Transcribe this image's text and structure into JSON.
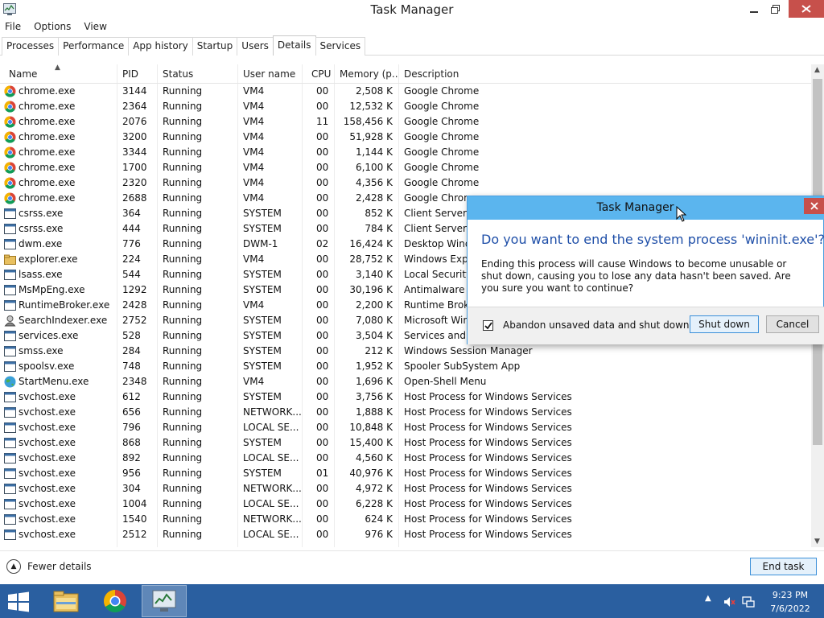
{
  "window": {
    "title": "Task Manager",
    "menu": [
      "File",
      "Options",
      "View"
    ],
    "tabs": [
      "Processes",
      "Performance",
      "App history",
      "Startup",
      "Users",
      "Details",
      "Services"
    ],
    "active_tab": "Details"
  },
  "table": {
    "columns": [
      "Name",
      "PID",
      "Status",
      "User name",
      "CPU",
      "Memory (p...",
      "Description"
    ],
    "rows": [
      {
        "name": "chrome.exe",
        "pid": "3144",
        "status": "Running",
        "user": "VM4",
        "cpu": "00",
        "mem": "2,508 K",
        "desc": "Google Chrome",
        "icon": "chrome-icon"
      },
      {
        "name": "chrome.exe",
        "pid": "2364",
        "status": "Running",
        "user": "VM4",
        "cpu": "00",
        "mem": "12,532 K",
        "desc": "Google Chrome",
        "icon": "chrome-icon"
      },
      {
        "name": "chrome.exe",
        "pid": "2076",
        "status": "Running",
        "user": "VM4",
        "cpu": "11",
        "mem": "158,456 K",
        "desc": "Google Chrome",
        "icon": "chrome-icon"
      },
      {
        "name": "chrome.exe",
        "pid": "3200",
        "status": "Running",
        "user": "VM4",
        "cpu": "00",
        "mem": "51,928 K",
        "desc": "Google Chrome",
        "icon": "chrome-icon"
      },
      {
        "name": "chrome.exe",
        "pid": "3344",
        "status": "Running",
        "user": "VM4",
        "cpu": "00",
        "mem": "1,144 K",
        "desc": "Google Chrome",
        "icon": "chrome-icon"
      },
      {
        "name": "chrome.exe",
        "pid": "1700",
        "status": "Running",
        "user": "VM4",
        "cpu": "00",
        "mem": "6,100 K",
        "desc": "Google Chrome",
        "icon": "chrome-icon"
      },
      {
        "name": "chrome.exe",
        "pid": "2320",
        "status": "Running",
        "user": "VM4",
        "cpu": "00",
        "mem": "4,356 K",
        "desc": "Google Chrome",
        "icon": "chrome-icon"
      },
      {
        "name": "chrome.exe",
        "pid": "2688",
        "status": "Running",
        "user": "VM4",
        "cpu": "00",
        "mem": "2,428 K",
        "desc": "Google Chrom",
        "icon": "chrome-icon"
      },
      {
        "name": "csrss.exe",
        "pid": "364",
        "status": "Running",
        "user": "SYSTEM",
        "cpu": "00",
        "mem": "852 K",
        "desc": "Client Server R",
        "icon": "system-process-icon"
      },
      {
        "name": "csrss.exe",
        "pid": "444",
        "status": "Running",
        "user": "SYSTEM",
        "cpu": "00",
        "mem": "784 K",
        "desc": "Client Server R",
        "icon": "system-process-icon"
      },
      {
        "name": "dwm.exe",
        "pid": "776",
        "status": "Running",
        "user": "DWM-1",
        "cpu": "02",
        "mem": "16,424 K",
        "desc": "Desktop Windo",
        "icon": "system-process-icon"
      },
      {
        "name": "explorer.exe",
        "pid": "224",
        "status": "Running",
        "user": "VM4",
        "cpu": "00",
        "mem": "28,752 K",
        "desc": "Windows Explo",
        "icon": "folder-icon"
      },
      {
        "name": "lsass.exe",
        "pid": "544",
        "status": "Running",
        "user": "SYSTEM",
        "cpu": "00",
        "mem": "3,140 K",
        "desc": "Local Security",
        "icon": "system-process-icon"
      },
      {
        "name": "MsMpEng.exe",
        "pid": "1292",
        "status": "Running",
        "user": "SYSTEM",
        "cpu": "00",
        "mem": "30,196 K",
        "desc": "Antimalware S",
        "icon": "system-process-icon"
      },
      {
        "name": "RuntimeBroker.exe",
        "pid": "2428",
        "status": "Running",
        "user": "VM4",
        "cpu": "00",
        "mem": "2,200 K",
        "desc": "Runtime Broke",
        "icon": "system-process-icon"
      },
      {
        "name": "SearchIndexer.exe",
        "pid": "2752",
        "status": "Running",
        "user": "SYSTEM",
        "cpu": "00",
        "mem": "7,080 K",
        "desc": "Microsoft Win",
        "icon": "search-indexer-icon"
      },
      {
        "name": "services.exe",
        "pid": "528",
        "status": "Running",
        "user": "SYSTEM",
        "cpu": "00",
        "mem": "3,504 K",
        "desc": "Services and C",
        "icon": "system-process-icon"
      },
      {
        "name": "smss.exe",
        "pid": "284",
        "status": "Running",
        "user": "SYSTEM",
        "cpu": "00",
        "mem": "212 K",
        "desc": "Windows Session Manager",
        "icon": "system-process-icon"
      },
      {
        "name": "spoolsv.exe",
        "pid": "748",
        "status": "Running",
        "user": "SYSTEM",
        "cpu": "00",
        "mem": "1,952 K",
        "desc": "Spooler SubSystem App",
        "icon": "system-process-icon"
      },
      {
        "name": "StartMenu.exe",
        "pid": "2348",
        "status": "Running",
        "user": "VM4",
        "cpu": "00",
        "mem": "1,696 K",
        "desc": "Open-Shell Menu",
        "icon": "globe-icon"
      },
      {
        "name": "svchost.exe",
        "pid": "612",
        "status": "Running",
        "user": "SYSTEM",
        "cpu": "00",
        "mem": "3,756 K",
        "desc": "Host Process for Windows Services",
        "icon": "system-process-icon"
      },
      {
        "name": "svchost.exe",
        "pid": "656",
        "status": "Running",
        "user": "NETWORK...",
        "cpu": "00",
        "mem": "1,888 K",
        "desc": "Host Process for Windows Services",
        "icon": "system-process-icon"
      },
      {
        "name": "svchost.exe",
        "pid": "796",
        "status": "Running",
        "user": "LOCAL SE...",
        "cpu": "00",
        "mem": "10,848 K",
        "desc": "Host Process for Windows Services",
        "icon": "system-process-icon"
      },
      {
        "name": "svchost.exe",
        "pid": "868",
        "status": "Running",
        "user": "SYSTEM",
        "cpu": "00",
        "mem": "15,400 K",
        "desc": "Host Process for Windows Services",
        "icon": "system-process-icon"
      },
      {
        "name": "svchost.exe",
        "pid": "892",
        "status": "Running",
        "user": "LOCAL SE...",
        "cpu": "00",
        "mem": "4,560 K",
        "desc": "Host Process for Windows Services",
        "icon": "system-process-icon"
      },
      {
        "name": "svchost.exe",
        "pid": "956",
        "status": "Running",
        "user": "SYSTEM",
        "cpu": "01",
        "mem": "40,976 K",
        "desc": "Host Process for Windows Services",
        "icon": "system-process-icon"
      },
      {
        "name": "svchost.exe",
        "pid": "304",
        "status": "Running",
        "user": "NETWORK...",
        "cpu": "00",
        "mem": "4,972 K",
        "desc": "Host Process for Windows Services",
        "icon": "system-process-icon"
      },
      {
        "name": "svchost.exe",
        "pid": "1004",
        "status": "Running",
        "user": "LOCAL SE...",
        "cpu": "00",
        "mem": "6,228 K",
        "desc": "Host Process for Windows Services",
        "icon": "system-process-icon"
      },
      {
        "name": "svchost.exe",
        "pid": "1540",
        "status": "Running",
        "user": "NETWORK...",
        "cpu": "00",
        "mem": "624 K",
        "desc": "Host Process for Windows Services",
        "icon": "system-process-icon"
      },
      {
        "name": "svchost.exe",
        "pid": "2512",
        "status": "Running",
        "user": "LOCAL SE...",
        "cpu": "00",
        "mem": "976 K",
        "desc": "Host Process for Windows Services",
        "icon": "system-process-icon"
      }
    ]
  },
  "footer": {
    "fewer_details": "Fewer details",
    "end_task": "End task"
  },
  "dialog": {
    "title": "Task Manager",
    "heading": "Do you want to end the system process 'wininit.exe'?",
    "body": "Ending this process will cause Windows to become unusable or shut down, causing you to lose any data hasn't been saved. Are you sure you want to continue?",
    "checkbox_label": "Abandon unsaved data and shut down.",
    "checkbox_checked": true,
    "shutdown_label": "Shut down",
    "cancel_label": "Cancel"
  },
  "taskbar": {
    "time": "9:23 PM",
    "date": "7/6/2022",
    "items": [
      "file-explorer-icon",
      "chrome-icon",
      "task-manager-icon"
    ]
  },
  "colors": {
    "accent": "#1f4fa8",
    "dialog_titlebar": "#5bb5ee",
    "close_button": "#c7504b",
    "taskbar": "#2a5fa0"
  }
}
